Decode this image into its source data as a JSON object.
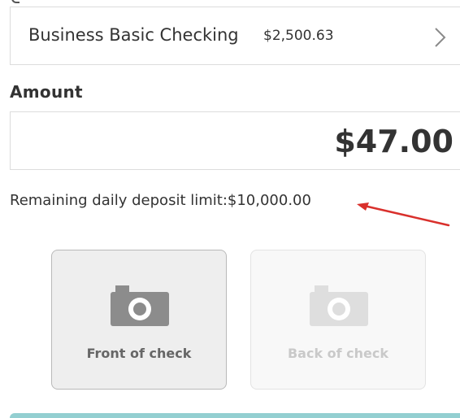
{
  "account": {
    "name": "Business Basic Checking",
    "balance": "$2,500.63"
  },
  "amount": {
    "label": "Amount",
    "value": "$47.00"
  },
  "deposit_limit": {
    "text": "Remaining daily deposit limit:$10,000.00"
  },
  "check_images": {
    "front_label": "Front of check",
    "back_label": "Back of check"
  },
  "icons": {
    "chevron": "chevron-right-icon",
    "camera": "camera-icon"
  },
  "colors": {
    "annotation_arrow": "#d9302c",
    "primary_bar": "#93cfd1",
    "text": "#333333"
  }
}
